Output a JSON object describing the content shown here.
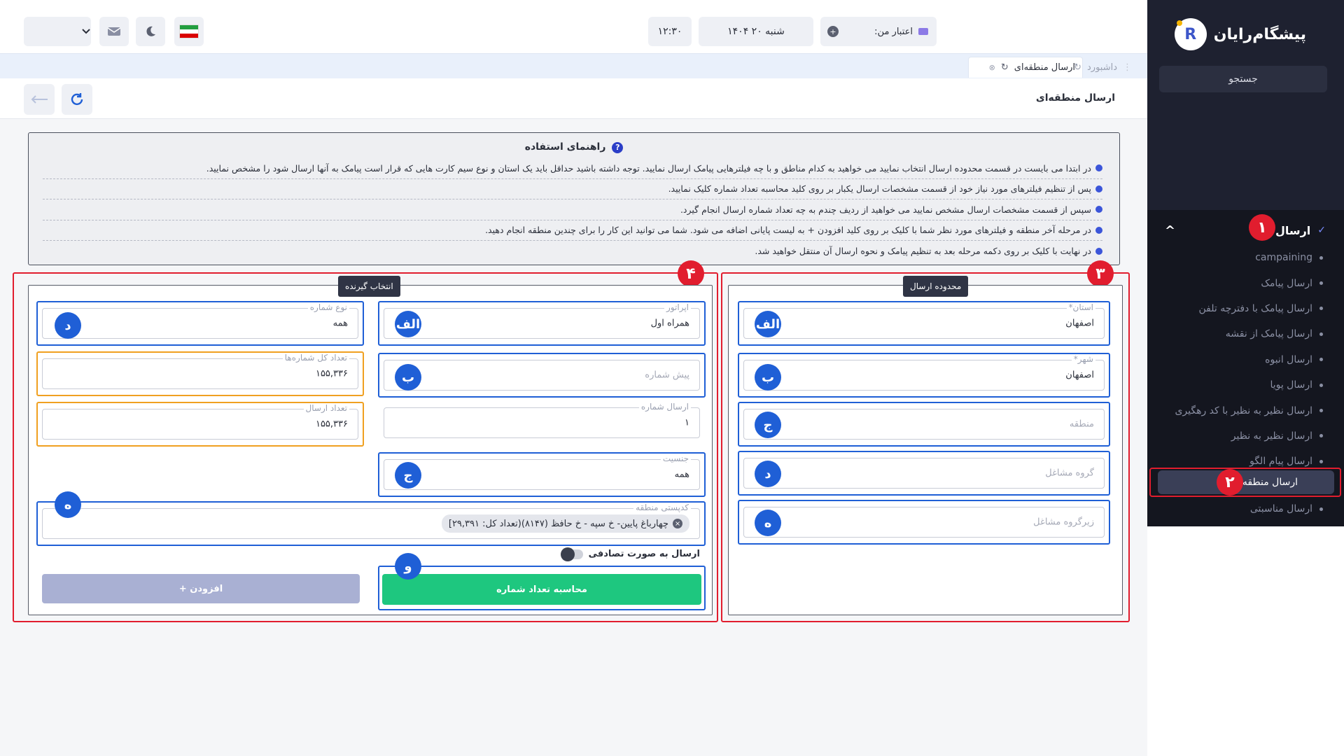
{
  "sidebar": {
    "brand": "پیشگام‌رایان",
    "search": "جستجو",
    "section_title": "ارسال",
    "items": [
      "campaining",
      "ارسال پیامک",
      "ارسال پیامک با دفترچه تلفن",
      "ارسال پیامک از نقشه",
      "ارسال انبوه",
      "ارسال پویا",
      "ارسال نظیر به نظیر با کد رهگیری",
      "ارسال نظیر به نظیر",
      "ارسال پیام الگو"
    ],
    "active_item": "ارسال منطقه‌ای",
    "after_item": "ارسال مناسبتی",
    "callout_1": "۱",
    "callout_2": "۲"
  },
  "topbar": {
    "credit_label": "اعتبار من:",
    "date": "شنبه ۲۰ ۱۴۰۴",
    "time": "۱۲:۳۰"
  },
  "tabs": {
    "active": "ارسال منطقه‌ای",
    "dashboard": "داشبورد"
  },
  "page": {
    "title": "ارسال منطقه‌ای"
  },
  "guide": {
    "title": "راهنمای استفاده",
    "lines": [
      "در ابتدا می بایست در قسمت محدوده ارسال انتخاب نمایید می خواهید به کدام مناطق و با چه فیلترهایی پیامک ارسال نمایید. توجه داشته باشید حداقل باید یک استان و نوع سیم کارت هایی که قرار است پیامک به آنها ارسال شود را مشخص نمایید.",
      "پس از تنظیم فیلترهای مورد نیاز خود از قسمت مشخصات ارسال یکبار بر روی کلید محاسبه تعداد شماره  کلیک نمایید.",
      "سپس از قسمت مشخصات ارسال مشخص نمایید می خواهید از ردیف چندم به چه تعداد شماره ارسال انجام گیرد.",
      "در مرحله آخر منطقه و فیلترهای مورد نظر شما با کلیک بر روی کلید افزودن +  به لیست پایانی اضافه می شود. شما می توانید این کار را برای چندین منطقه انجام دهید.",
      "در نهایت با کلیک بر روی دکمه مرحله بعد به تنظیم پیامک و نحوه ارسال آن منتقل خواهید شد."
    ]
  },
  "range_panel": {
    "label": "محدوده ارسال",
    "callout": "۳",
    "fields": [
      {
        "label": "استان*",
        "value": "اصفهان",
        "badge": "الف"
      },
      {
        "label": "شهر*",
        "value": "اصفهان",
        "badge": "ب"
      },
      {
        "label": "",
        "placeholder": "منطقه",
        "badge": "ج"
      },
      {
        "label": "",
        "placeholder": "گروه مشاغل",
        "badge": "د"
      },
      {
        "label": "",
        "placeholder": "زیرگروه مشاغل",
        "badge": "ه"
      }
    ]
  },
  "recipient_panel": {
    "label": "انتخاب گیرنده",
    "callout": "۴",
    "operator": {
      "label": "اپراتور",
      "value": "همراه اول",
      "badge": "الف"
    },
    "prefix": {
      "placeholder": "پیش شماره",
      "badge": "ب"
    },
    "send_number": {
      "label": "ارسال شماره",
      "value": "۱"
    },
    "gender": {
      "label": "جنسیت",
      "value": "همه",
      "badge": "ج"
    },
    "number_type": {
      "label": "نوع شماره",
      "value": "همه",
      "badge": "د"
    },
    "total_count": {
      "label": "تعداد کل شماره‌ها",
      "value": "۱۵۵,۳۳۶"
    },
    "send_count": {
      "label": "تعداد ارسال",
      "value": "۱۵۵,۳۳۶"
    },
    "postal": {
      "label": "کدپستی منطقه",
      "chip": "چهارباغ پایین- خ سپه - خ حافظ (۸۱۴۷)(تعداد کل: ۲۹,۳۹۱]",
      "badge": "ه"
    },
    "random_label": "ارسال به صورت تصادفی",
    "calc_button": "محاسبه تعداد شماره",
    "calc_badge": "و",
    "add_button": "افزودن +"
  },
  "colors": {
    "accent_blue": "#1f5fd6",
    "highlight_red": "#e11d2e",
    "green": "#1ec77f",
    "orange": "#f0a020"
  }
}
